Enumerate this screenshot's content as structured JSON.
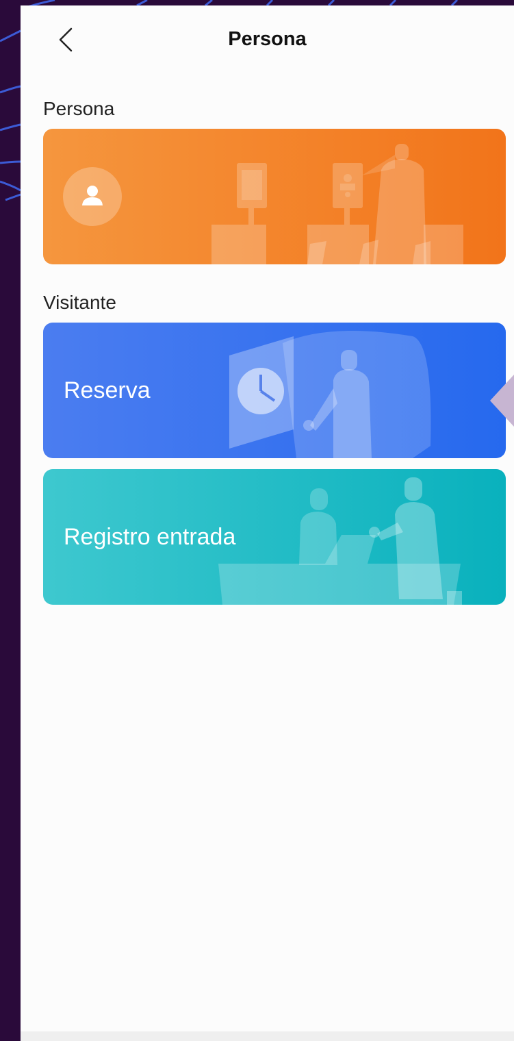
{
  "header": {
    "title": "Persona",
    "back_icon": "chevron-left-icon"
  },
  "sections": [
    {
      "label": "Persona",
      "cards": [
        {
          "label": "",
          "icon": "person-avatar-icon",
          "color": "#f2741a"
        }
      ]
    },
    {
      "label": "Visitante",
      "cards": [
        {
          "label": "Reserva",
          "color": "#2669ee"
        },
        {
          "label": "Registro entrada",
          "color": "#09b1bd"
        }
      ]
    }
  ],
  "colors": {
    "background": "#2a0a3a",
    "surface": "#fcfcfc",
    "orange": "#f2741a",
    "blue": "#2669ee",
    "teal": "#09b1bd"
  }
}
